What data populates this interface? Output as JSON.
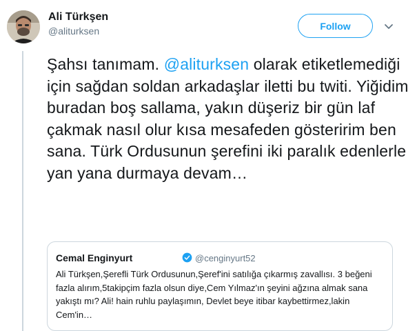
{
  "tweet": {
    "author_name": "Ali Türkşen",
    "author_handle": "@aliturksen",
    "follow_label": "Follow",
    "text_before": "Şahsı tanımam. ",
    "mention": "@aliturksen",
    "text_after": " olarak etiketlemediği için sağdan soldan arkadaşlar iletti bu twiti. Yiğidim buradan boş sallama, yakın düşeriz bir gün laf çakmak nasıl olur kısa mesafeden gösteririm ben sana. Türk Ordusunun şerefini iki paralık edenlerle yan yana durmaya devam…"
  },
  "quoted_tweet": {
    "author_name": "Cemal Enginyurt",
    "author_handle": "@cenginyurt52",
    "text": "Ali Türkşen,Şerefli Türk Ordusunun,Şeref'ini satılığa çıkarmış zavallısı. 3 beğeni fazla alırım,5takipçim fazla olsun diye,Cem Yılmaz'ın şeyini ağzına almak sana yakıştı mı? Ali! hain ruhlu paylaşımın, Devlet beye itibar kaybettirmez,lakin Cem'in…"
  },
  "icons": {
    "avatar": "author-avatar",
    "caret": "chevron-down-icon",
    "verified": "verified-badge-icon"
  },
  "colors": {
    "accent": "#1da1f2",
    "text": "#14171a",
    "secondary": "#657786",
    "border": "#ccd6dd"
  }
}
